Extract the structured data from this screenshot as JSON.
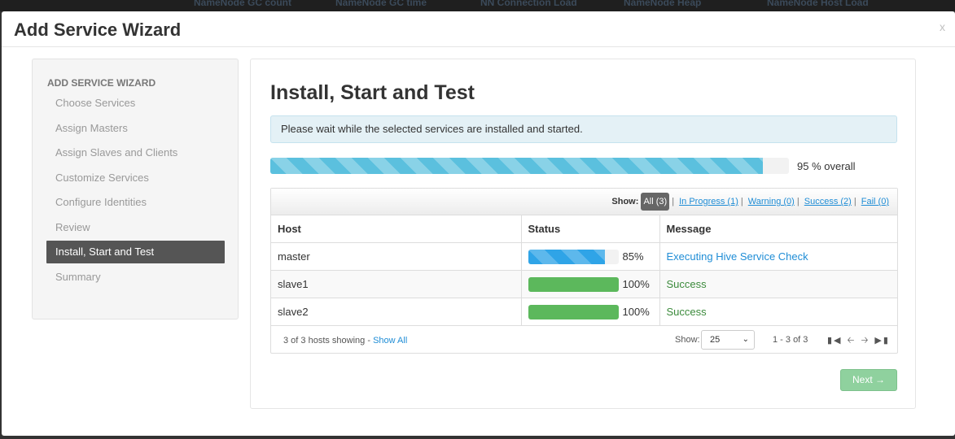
{
  "background": {
    "columns": [
      "NameNode GC count",
      "NameNode GC time",
      "NN Connection Load",
      "NameNode Heap",
      "NameNode Host Load"
    ]
  },
  "modal": {
    "title": "Add Service Wizard",
    "close_label": "x"
  },
  "sidebar": {
    "heading": "ADD SERVICE WIZARD",
    "items": [
      {
        "label": "Choose Services",
        "active": false
      },
      {
        "label": "Assign Masters",
        "active": false
      },
      {
        "label": "Assign Slaves and Clients",
        "active": false
      },
      {
        "label": "Customize Services",
        "active": false
      },
      {
        "label": "Configure Identities",
        "active": false
      },
      {
        "label": "Review",
        "active": false
      },
      {
        "label": "Install, Start and Test",
        "active": true
      },
      {
        "label": "Summary",
        "active": false
      }
    ]
  },
  "main": {
    "title": "Install, Start and Test",
    "alert": "Please wait while the selected services are installed and started.",
    "overall_progress": 95,
    "overall_label": "95 % overall",
    "filter": {
      "show_label": "Show:",
      "all": "All (3)",
      "in_progress": "In Progress (1)",
      "warning": "Warning (0)",
      "success": "Success (2)",
      "fail": "Fail (0)"
    },
    "table": {
      "headers": [
        "Host",
        "Status",
        "Message"
      ],
      "rows": [
        {
          "host": "master",
          "progress": 85,
          "percent": "85%",
          "message": "Executing Hive Service Check",
          "state": "in-progress"
        },
        {
          "host": "slave1",
          "progress": 100,
          "percent": "100%",
          "message": "Success",
          "state": "success"
        },
        {
          "host": "slave2",
          "progress": 100,
          "percent": "100%",
          "message": "Success",
          "state": "success"
        }
      ]
    },
    "footer": {
      "showing": "3 of 3 hosts showing",
      "show_all": "Show All",
      "show_label": "Show:",
      "page_size": "25",
      "range": "1 - 3 of 3"
    },
    "next_button": "Next →"
  },
  "colors": {
    "progress_overall": "#5bc0de",
    "progress_in_progress": "#2fa4e7",
    "progress_success": "#5cb85c",
    "active_nav": "#555555",
    "next_button": "#8fd19e"
  }
}
